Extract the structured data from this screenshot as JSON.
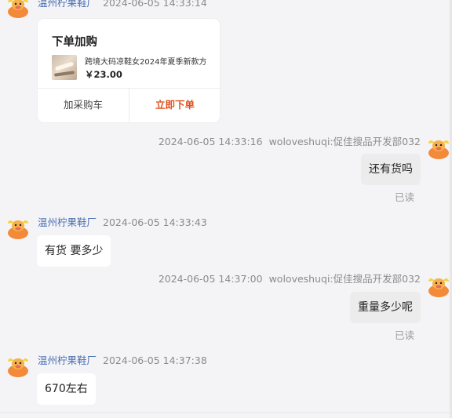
{
  "messages": [
    {
      "sender": "温州柠果鞋厂",
      "time": "2024-06-05 14:33:14"
    },
    {
      "sender": "woloveshuqi:促佳搜品开发部032",
      "time": "2024-06-05 14:33:16",
      "text": "还有货吗",
      "status": "已读"
    },
    {
      "sender": "温州柠果鞋厂",
      "time": "2024-06-05 14:33:43",
      "text": "有货 要多少"
    },
    {
      "sender": "woloveshuqi:促佳搜品开发部032",
      "time": "2024-06-05 14:37:00",
      "text": "重量多少呢",
      "status": "已读"
    },
    {
      "sender": "温州柠果鞋厂",
      "time": "2024-06-05 14:37:38",
      "text": "670左右"
    }
  ],
  "order_card": {
    "title": "下单加购",
    "product_name": "跨境大码凉鞋女2024年夏季新款方",
    "price": "￥23.00",
    "add_to_cart_label": "加采购车",
    "buy_now_label": "立即下单"
  },
  "colors": {
    "background": "#f4f4f6",
    "sender_name": "#4a6fb3",
    "buy_button": "#e0521f",
    "my_bubble": "#ececec",
    "avatar_orange": "#f28a3a"
  },
  "icons": {
    "avatar": "cow-avatar-icon"
  }
}
